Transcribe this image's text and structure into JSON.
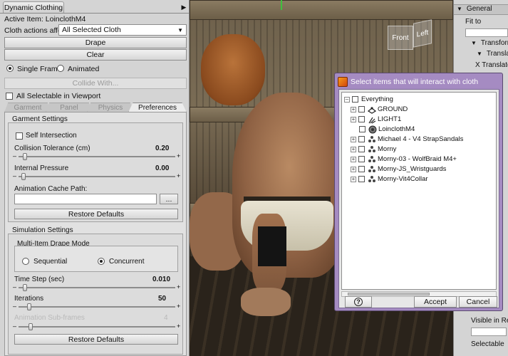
{
  "left_panel": {
    "tab_title": "Dynamic Clothing",
    "active_item_label": "Active Item: LoinclothM4",
    "cloth_actions_label": "Cloth actions affect:",
    "cloth_actions_value": "All Selected Cloth",
    "drape_label": "Drape",
    "clear_label": "Clear",
    "single_frame_label": "Single Frame",
    "animated_label": "Animated",
    "collide_with_label": "Collide With...",
    "all_selectable_label": "All Selectable in Viewport",
    "tabs": [
      "Garment",
      "Panel",
      "Physics",
      "Preferences"
    ],
    "active_tab": "Preferences",
    "garment_settings": {
      "title": "Garment Settings",
      "self_intersection_label": "Self Intersection",
      "collision_tolerance_label": "Collision Tolerance (cm)",
      "collision_tolerance_value": "0.20",
      "internal_pressure_label": "Internal Pressure",
      "internal_pressure_value": "0.00",
      "cache_path_label": "Animation Cache Path:",
      "cache_path_value": "",
      "browse_label": "...",
      "restore_label": "Restore Defaults"
    },
    "simulation_settings": {
      "title": "Simulation Settings",
      "drape_mode_title": "Multi-Item Drape Mode",
      "sequential_label": "Sequential",
      "concurrent_label": "Concurrent",
      "time_step_label": "Time Step (sec)",
      "time_step_value": "0.010",
      "iterations_label": "Iterations",
      "iterations_value": "50",
      "substeps_label": "Animation Sub-frames",
      "substeps_value": "4",
      "restore_label": "Restore Defaults"
    }
  },
  "viewport": {
    "cube_front": "Front",
    "cube_left": "Left"
  },
  "right_panel": {
    "general_label": "General",
    "fit_to_label": "Fit to",
    "transforms_label": "Transforms",
    "translate_label": "Translation",
    "x_translate_label": "X Translate",
    "visible_label": "Visible in Render",
    "selectable_label": "Selectable"
  },
  "dialog": {
    "title": "Select items that will interact with cloth",
    "items": [
      {
        "label": "Everything",
        "icon": "none",
        "expander": "minus"
      },
      {
        "label": "GROUND",
        "icon": "ground-icon",
        "expander": "plus"
      },
      {
        "label": "LIGHT1",
        "icon": "light-icon",
        "expander": "plus"
      },
      {
        "label": "LoinclothM4",
        "icon": "cloth-icon",
        "expander": "none"
      },
      {
        "label": "Michael 4 - V4 StrapSandals",
        "icon": "figure-icon",
        "expander": "plus"
      },
      {
        "label": "Morny",
        "icon": "figure-icon",
        "expander": "plus"
      },
      {
        "label": "Morny-03 - WolfBraid M4+",
        "icon": "figure-icon",
        "expander": "plus"
      },
      {
        "label": "Morny-JS_Wristguards",
        "icon": "figure-icon",
        "expander": "plus"
      },
      {
        "label": "Morny-Vit4Collar",
        "icon": "figure-icon",
        "expander": "plus"
      }
    ],
    "help_label": "?",
    "accept_label": "Accept",
    "cancel_label": "Cancel"
  }
}
